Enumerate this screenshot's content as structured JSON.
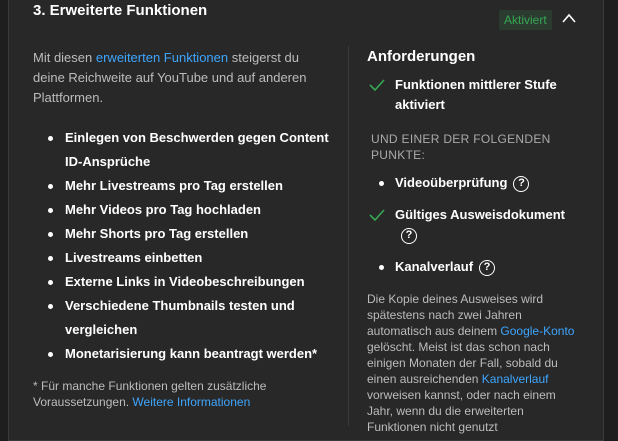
{
  "section": {
    "title": "3. Erweiterte Funktionen",
    "status_badge": "Aktiviert"
  },
  "intro": {
    "before": "Mit diesen ",
    "link": "erweiterten Funktionen",
    "after": " steigerst du deine Reichweite auf YouTube und auf anderen Plattformen."
  },
  "features": [
    "Einlegen von Beschwerden gegen Content ID-Ansprüche",
    "Mehr Livestreams pro Tag erstellen",
    "Mehr Videos pro Tag hochladen",
    "Mehr Shorts pro Tag erstellen",
    "Livestreams einbetten",
    "Externe Links in Videobeschreibungen",
    "Verschiedene Thumbnails testen und vergleichen",
    "Monetarisierung kann beantragt werden*"
  ],
  "footnote": {
    "text": "* Für manche Funktionen gelten zusätzliche Voraussetzungen. ",
    "link": "Weitere Informationen"
  },
  "requirements": {
    "title": "Anforderungen",
    "main": "Funktionen mittlerer Stufe aktiviert",
    "sub_heading": "UND EINER DER FOLGENDEN PUNKTE:",
    "options": [
      {
        "label": "Videoüberprüfung",
        "state": "bullet"
      },
      {
        "label": "Gültiges Ausweisdokument",
        "state": "check"
      },
      {
        "label": "Kanalverlauf",
        "state": "bullet"
      }
    ],
    "help_glyph": "?",
    "para_1": "Die Kopie deines Ausweises wird spätestens nach zwei Jahren automatisch aus deinem ",
    "para_link_1": "Google-Konto",
    "para_2": " gelöscht. Meist ist das schon nach einigen Monaten der Fall, sobald du einen ausreichenden ",
    "para_link_2": "Kanalverlauf",
    "para_3": " vorweisen kannst, oder nach einem Jahr, wenn du die erweiterten Funktionen nicht genutzt"
  },
  "colors": {
    "background": "#282828",
    "accent_link": "#3ea6ff",
    "status_green": "#36a853"
  }
}
